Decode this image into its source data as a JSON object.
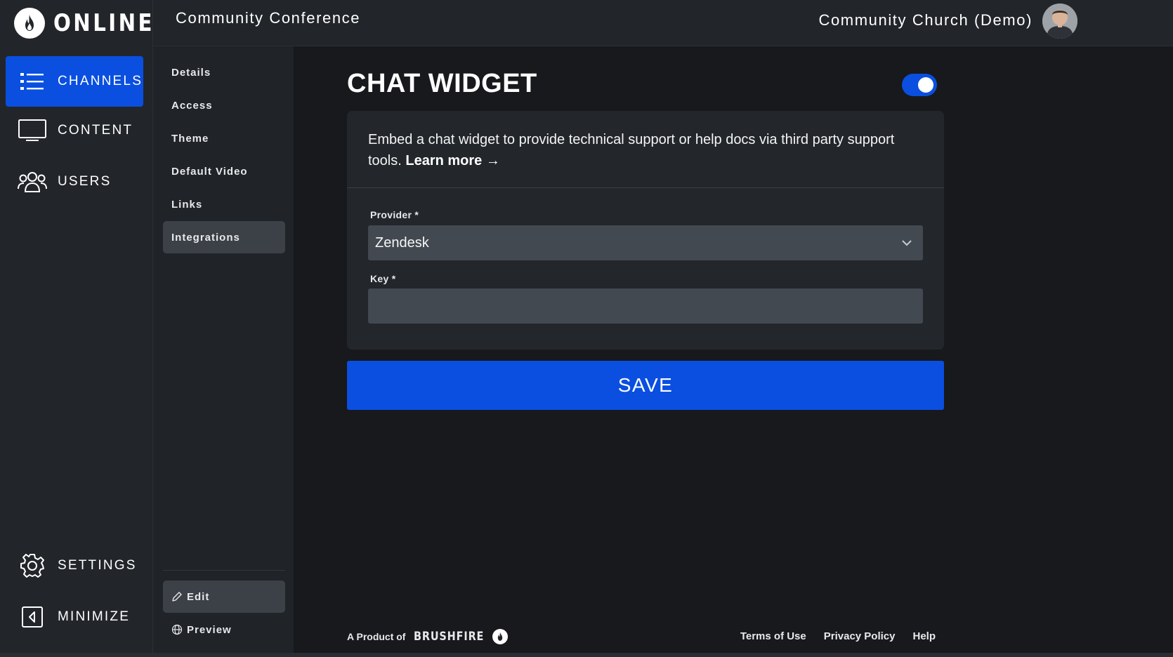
{
  "brand": {
    "name": "ONLINE"
  },
  "nav": {
    "items": [
      {
        "label": "CHANNELS",
        "icon": "list-icon",
        "active": true
      },
      {
        "label": "CONTENT",
        "icon": "monitor-icon",
        "active": false
      },
      {
        "label": "USERS",
        "icon": "users-icon",
        "active": false
      }
    ],
    "bottom": [
      {
        "label": "SETTINGS",
        "icon": "gear-icon"
      },
      {
        "label": "MINIMIZE",
        "icon": "collapse-icon"
      }
    ]
  },
  "header": {
    "title": "Community Conference",
    "org": "Community Church (Demo)"
  },
  "subnav": {
    "items": [
      {
        "label": "Details",
        "active": false
      },
      {
        "label": "Access",
        "active": false
      },
      {
        "label": "Theme",
        "active": false
      },
      {
        "label": "Default Video",
        "active": false
      },
      {
        "label": "Links",
        "active": false
      },
      {
        "label": "Integrations",
        "active": true
      }
    ],
    "edit_label": "Edit",
    "preview_label": "Preview"
  },
  "main": {
    "title": "CHAT WIDGET",
    "toggle_on": true,
    "description": "Embed a chat widget to provide technical support or help docs via third party support tools.",
    "learn_more": "Learn more",
    "provider_label": "Provider *",
    "provider_value": "Zendesk",
    "key_label": "Key *",
    "key_value": "",
    "save_label": "SAVE"
  },
  "footer": {
    "product_of": "A Product of",
    "brand": "BRUSHFIRE",
    "links": [
      "Terms of Use",
      "Privacy Policy",
      "Help"
    ]
  },
  "colors": {
    "accent": "#0a4fe0",
    "background": "#17191c",
    "sidebar": "#22252a",
    "input": "#434950"
  }
}
